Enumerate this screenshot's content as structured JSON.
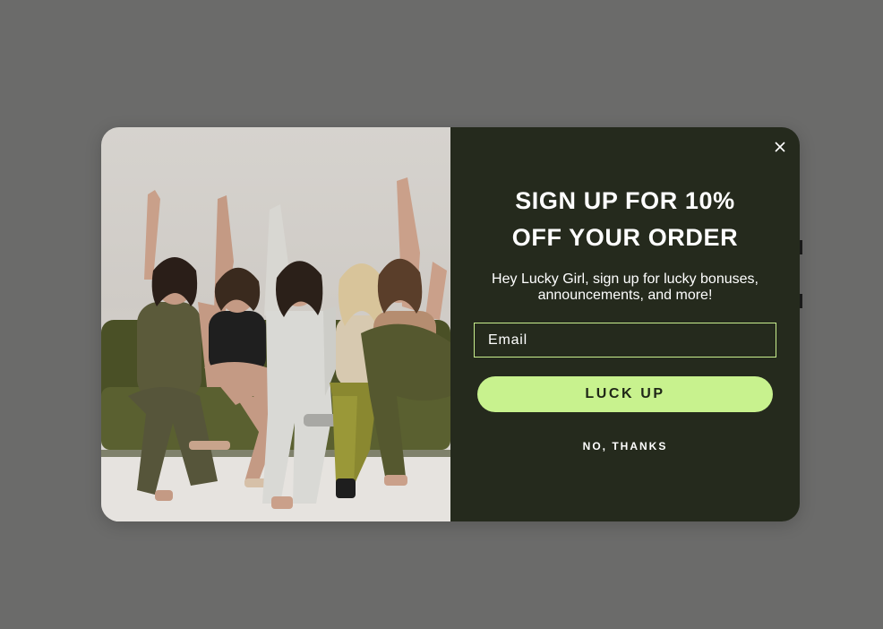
{
  "popup": {
    "image_alt": "Five women sitting on an olive green sofa with arms raised, smiling",
    "headline_line1": "SIGN UP FOR 10%",
    "headline_line2": "OFF YOUR ORDER",
    "subtext": "Hey Lucky Girl, sign up for lucky bonuses, announcements, and more!",
    "email_placeholder": "Email",
    "email_value": "",
    "submit_label": "LUCK UP",
    "decline_label": "NO, THANKS",
    "close_icon": "close-icon"
  },
  "colors": {
    "overlay": "#6b6b6a",
    "panel": "#252a1d",
    "accent": "#c8f28e",
    "input_border": "#c9ef8e",
    "text": "#ffffff"
  }
}
